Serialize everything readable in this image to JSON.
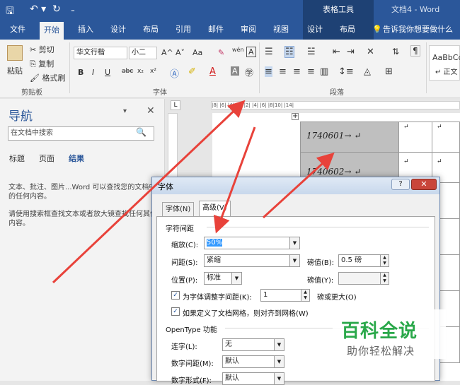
{
  "titlebar": {
    "context_title": "表格工具",
    "doc_title": "文档4 - Word",
    "qa_save": "🖫",
    "qa_undo": "↶ ▾",
    "qa_redo": "↻",
    "qa_more": "₌"
  },
  "tabs": {
    "file": "文件",
    "home": "开始",
    "insert": "插入",
    "design": "设计",
    "layout": "布局",
    "references": "引用",
    "mailings": "邮件",
    "review": "审阅",
    "view": "视图",
    "table_design": "设计",
    "table_layout": "布局",
    "tellme": "告诉我你想要做什么"
  },
  "ribbon": {
    "clipboard": {
      "paste": "粘贴",
      "cut": "剪切",
      "copy": "复制",
      "format_painter": "格式刷",
      "label": "剪贴板"
    },
    "font": {
      "font_name": "华文行楷",
      "font_size": "小二",
      "label": "字体",
      "bold": "B",
      "italic": "I",
      "underline": "U",
      "strike": "abc",
      "sub": "x₂",
      "sup": "x²",
      "grow": "A^",
      "shrink": "A˅",
      "case": "Aa",
      "clear": "✎",
      "phonetic": "wén",
      "border_char": "A"
    },
    "paragraph": {
      "label": "段落"
    },
    "styles": {
      "preview": "AaBbCc",
      "normal": "↵ 正文"
    }
  },
  "nav": {
    "title": "导航",
    "search_placeholder": "在文档中搜索",
    "tab_headings": "标题",
    "tab_pages": "页面",
    "tab_results": "结果",
    "msg1": "文本、批注、图片...Word 可以查找您的文档中的任何内容。",
    "msg2": "请使用搜索框查找文本或者放大镜查找任何其他内容。"
  },
  "ruler": {
    "text": "|8|  |6|  |4|  |2|     |2|  |4|  |6|  |8|10|  |14|"
  },
  "table": {
    "row1": "1740601→ ↵",
    "row2": "1740602→ ↵",
    "mark": "↵"
  },
  "dialog": {
    "title": "字体",
    "help": "?",
    "close": "✕",
    "tab_font": "字体(N)",
    "tab_advanced": "高级(V)",
    "section_spacing": "字符间距",
    "scale_label": "缩放(C):",
    "scale_value": "50%",
    "spacing_label": "间距(S):",
    "spacing_value": "紧缩",
    "spacing_by_label": "磅值(B):",
    "spacing_by_value": "0.5 磅",
    "position_label": "位置(P):",
    "position_value": "标准",
    "position_by_label": "磅值(Y):",
    "position_by_value": "",
    "kerning_label": "为字体调整字间距(K):",
    "kerning_value": "1",
    "kerning_suffix": "磅或更大(O)",
    "grid_label": "如果定义了文档网格，则对齐到网格(W)",
    "section_opentype": "OpenType 功能",
    "ligatures_label": "连字(L):",
    "ligatures_value": "无",
    "num_spacing_label": "数字间距(M):",
    "num_spacing_value": "默认",
    "num_forms_label": "数字形式(F):",
    "num_forms_value": "默认"
  },
  "watermark": {
    "main": "百科全说",
    "sub": "助你轻松解决"
  },
  "colors": {
    "accent": "#2b579a",
    "annotation": "#e8423a",
    "watermark": "#2aa84a"
  }
}
